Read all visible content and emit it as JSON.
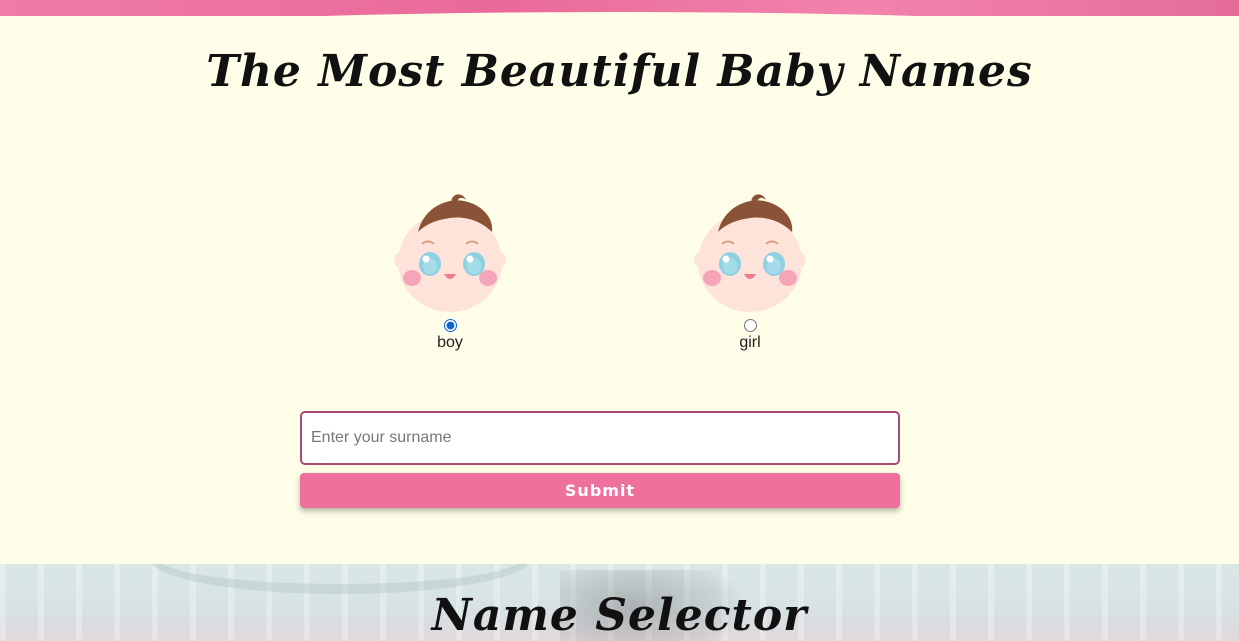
{
  "header": {
    "title": "The Most Beautiful Baby Names"
  },
  "gender_options": [
    {
      "label": "boy",
      "selected": true,
      "icon": "baby-face-icon"
    },
    {
      "label": "girl",
      "selected": false,
      "icon": "baby-face-icon"
    }
  ],
  "form": {
    "surname_placeholder": "Enter your surname",
    "surname_value": "",
    "submit_label": "Submit"
  },
  "section": {
    "title": "Name Selector"
  },
  "colors": {
    "background": "#fefee8",
    "accent": "#ee709d",
    "input_border": "#a84a72",
    "radio": "#0a64d6"
  }
}
